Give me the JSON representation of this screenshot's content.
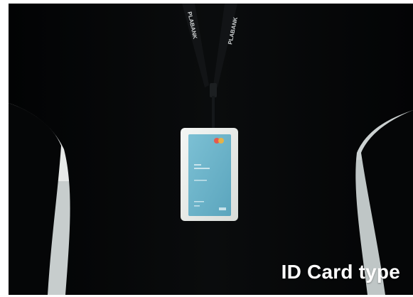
{
  "photo": {
    "caption": "ID Card type",
    "lanyard_text_left": "PLABANK",
    "lanyard_text_right": "PLABANK",
    "colors": {
      "shirt": "#050607",
      "card_face": "#6fb4c9",
      "holder": "#e9ece9",
      "backdrop": "#d8dcdb"
    },
    "icons": [
      "lanyard-clip-icon",
      "card-logo-icon"
    ]
  }
}
